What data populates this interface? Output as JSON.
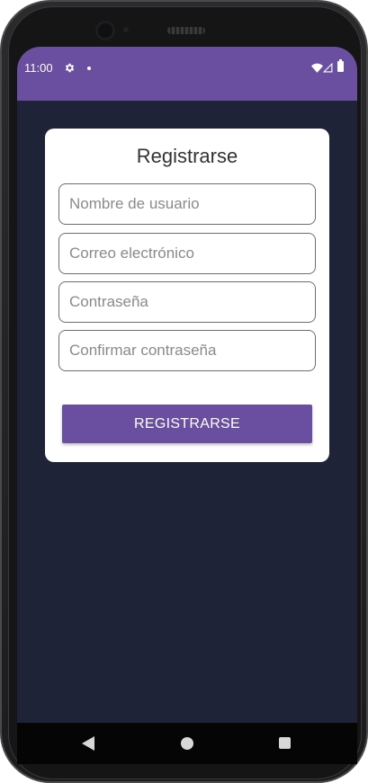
{
  "status_bar": {
    "time": "11:00",
    "icons": [
      "gear-icon",
      "notification-dot-icon",
      "wifi-icon",
      "signal-icon",
      "battery-icon"
    ],
    "color": "#6a4ea0"
  },
  "register_form": {
    "title": "Registrarse",
    "fields": {
      "username": {
        "value": "",
        "placeholder": "Nombre de usuario"
      },
      "email": {
        "value": "",
        "placeholder": "Correo electrónico"
      },
      "password": {
        "value": "",
        "placeholder": "Contraseña"
      },
      "confirm_password": {
        "value": "",
        "placeholder": "Confirmar contraseña"
      }
    },
    "submit_label": "REGISTRARSE"
  },
  "nav_bar": {
    "icons": [
      "back-icon",
      "home-icon",
      "recents-icon"
    ]
  },
  "colors": {
    "accent": "#6a4ea0",
    "background": "#1e2337",
    "card": "#ffffff"
  }
}
